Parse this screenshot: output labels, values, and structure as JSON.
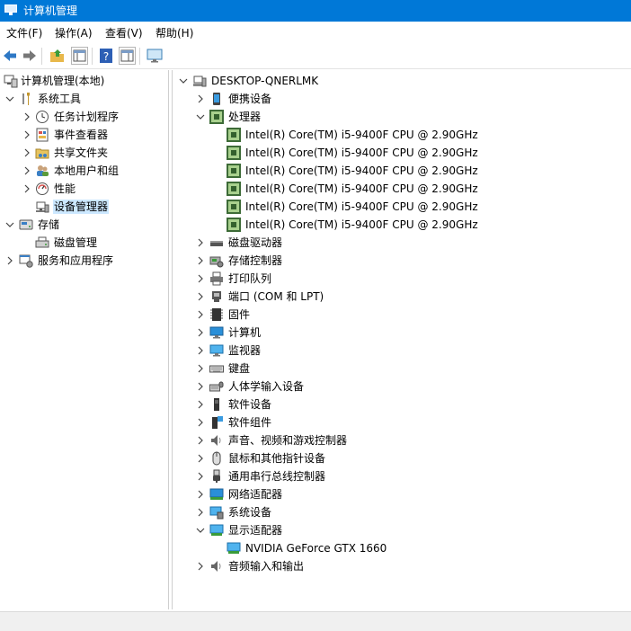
{
  "window": {
    "title": "计算机管理"
  },
  "menu": [
    "文件(F)",
    "操作(A)",
    "查看(V)",
    "帮助(H)"
  ],
  "toolbar": {
    "buttons": [
      "back-icon",
      "forward-icon",
      "up-folder-icon",
      "show-hide-console-tree-icon",
      "help-icon",
      "action-pane-icon",
      "monitor-icon"
    ]
  },
  "left_tree": {
    "root": "计算机管理(本地)",
    "system_tools": "系统工具",
    "items": [
      "任务计划程序",
      "事件查看器",
      "共享文件夹",
      "本地用户和组",
      "性能",
      "设备管理器"
    ],
    "storage": "存储",
    "disk_mgmt": "磁盘管理",
    "services": "服务和应用程序"
  },
  "right_tree": {
    "computer": "DESKTOP-QNERLMK",
    "portable": "便携设备",
    "processor": "处理器",
    "cpu_items": [
      "Intel(R) Core(TM) i5-9400F CPU @ 2.90GHz",
      "Intel(R) Core(TM) i5-9400F CPU @ 2.90GHz",
      "Intel(R) Core(TM) i5-9400F CPU @ 2.90GHz",
      "Intel(R) Core(TM) i5-9400F CPU @ 2.90GHz",
      "Intel(R) Core(TM) i5-9400F CPU @ 2.90GHz",
      "Intel(R) Core(TM) i5-9400F CPU @ 2.90GHz"
    ],
    "categories": [
      "磁盘驱动器",
      "存储控制器",
      "打印队列",
      "端口 (COM 和 LPT)",
      "固件",
      "计算机",
      "监视器",
      "键盘",
      "人体学输入设备",
      "软件设备",
      "软件组件",
      "声音、视频和游戏控制器",
      "鼠标和其他指针设备",
      "通用串行总线控制器",
      "网络适配器",
      "系统设备"
    ],
    "display": "显示适配器",
    "gpu": "NVIDIA GeForce GTX 1660",
    "audio_io": "音频输入和输出"
  },
  "colors": {
    "titlebar": "#0078d7",
    "selection": "#cce8ff",
    "statusbar": "#f0f0f0"
  }
}
